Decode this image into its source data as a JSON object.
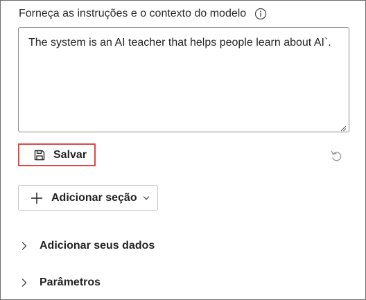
{
  "instructions": {
    "label": "Forneça as instruções e o contexto do modelo",
    "text": "The system is an AI teacher that helps people learn about AI`."
  },
  "actions": {
    "save_label": "Salvar",
    "add_section_label": "Adicionar seção"
  },
  "expanders": {
    "add_data_label": "Adicionar seus dados",
    "parameters_label": "Parâmetros"
  },
  "colors": {
    "highlight_border": "#e04848",
    "text": "#242424",
    "muted_icon": "#8a8a8a"
  },
  "icons": {
    "info": "info-icon",
    "save": "save-icon",
    "undo": "undo-icon",
    "plus": "plus-icon",
    "chevron_down": "chevron-down-icon",
    "chevron_right": "chevron-right-icon"
  }
}
